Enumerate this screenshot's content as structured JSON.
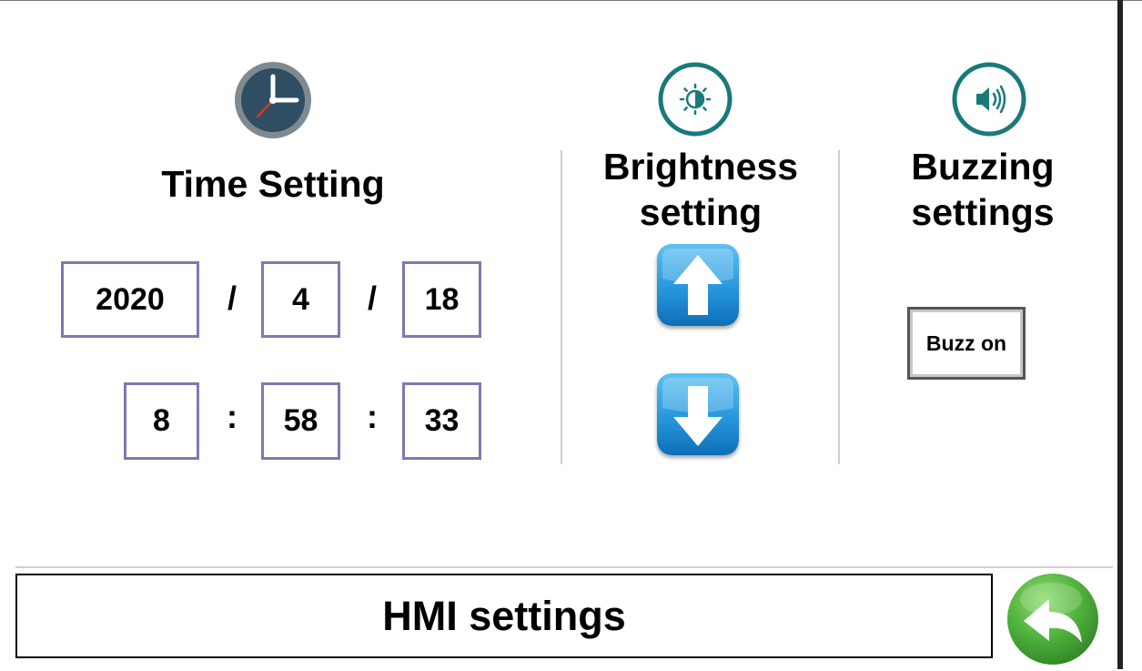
{
  "page": {
    "footer_title": "HMI settings"
  },
  "time_setting": {
    "title": "Time Setting",
    "icon": "clock-icon",
    "date": {
      "year": "2020",
      "month": "4",
      "day": "18",
      "separator": "/"
    },
    "time": {
      "hour": "8",
      "minute": "58",
      "second": "33",
      "separator": ":"
    }
  },
  "brightness": {
    "title": "Brightness\nsetting",
    "icon": "brightness-icon",
    "up_icon": "arrow-up-icon",
    "down_icon": "arrow-down-icon"
  },
  "buzzing": {
    "title": "Buzzing\nsettings",
    "icon": "speaker-icon",
    "button_label": "Buzz on"
  },
  "colors": {
    "field_border": "#7d78b4",
    "icon_teal": "#1a7a7a",
    "clock_face": "#2f4d63",
    "arrow_blue": "#1e8fd8",
    "back_green": "#4cae3a"
  }
}
